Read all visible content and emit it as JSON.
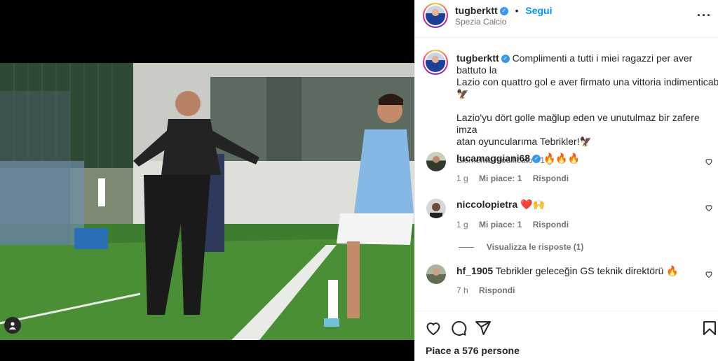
{
  "post": {
    "author": "tugberktt",
    "follow_label": "Segui",
    "location": "Spezia Calcio",
    "caption_p1": "Complimenti a tutti i miei ragazzi per aver battuto la",
    "caption_p2": "Lazio con quattro gol e aver firmato una vittoria indimenticabile!",
    "caption_p3": "🦅",
    "caption_p4": "Lazio'yu dört golle mağlup eden ve unutulmaz bir zafere imza",
    "caption_p5": "atan oyuncularıma Tebrikler!🦅",
    "edited": "Elemento modificato",
    "edited_time": "1 g",
    "likes": "Piace a 576 persone"
  },
  "comments": [
    {
      "user": "lucamaggiani68",
      "verified": true,
      "text": "🔥🔥🔥",
      "time": "1 g",
      "likes": "Mi piace: 1",
      "reply": "Rispondi"
    },
    {
      "user": "niccolopietra",
      "verified": false,
      "text": "❤️🙌",
      "time": "1 g",
      "likes": "Mi piace: 1",
      "reply": "Rispondi",
      "view_replies": "Visualizza le risposte (1)"
    },
    {
      "user": "hf_1905",
      "verified": false,
      "text": "Tebrikler geleceğin GS teknik direktörü 🔥",
      "time": "7 h",
      "likes": "",
      "reply": "Rispondi"
    }
  ],
  "icons": {
    "more": "more-icon",
    "like": "heart-icon",
    "comment": "comment-icon",
    "share": "share-icon",
    "save": "bookmark-icon",
    "tag": "user-tag-icon"
  }
}
